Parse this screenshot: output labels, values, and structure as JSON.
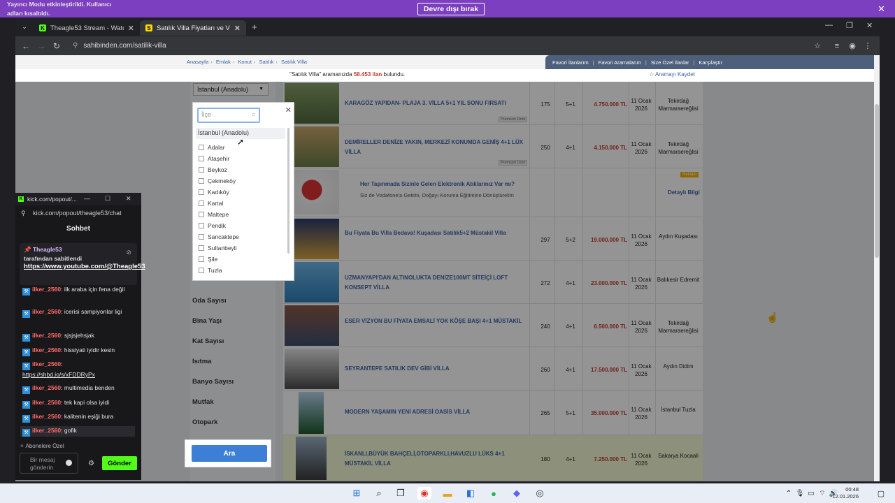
{
  "banner": {
    "message": "Yayıncı Modu etkinleştirildi. Kullanıcı adları kısaltıldı.",
    "button": "Devre dışı bırak",
    "close": "✕"
  },
  "browser": {
    "tabs": [
      {
        "title": "Theagle53 Stream - Watch Live",
        "favicon_letter": "K",
        "favicon_color": "#53fc18",
        "active": false
      },
      {
        "title": "Satılık Villa Fiyatları ve Villa İlan",
        "favicon_letter": "S",
        "favicon_color": "#ffd800",
        "active": true
      }
    ],
    "url": "sahibinden.com/satilik-villa"
  },
  "page": {
    "breadcrumb": [
      "Anasayfa",
      "Emlak",
      "Konut",
      "Satılık",
      "Satılık Villa"
    ],
    "fav_links": [
      "Favori İlanlarım",
      "Favori Aramalarım",
      "Size Özel İlanlar",
      "Karşılaştır"
    ],
    "result": {
      "query": "\"Satılık Villa\"",
      "pre": " aramanızda ",
      "count": "58.453 ilan",
      "post": " bulundu.",
      "save": "Aramayı Kaydet"
    },
    "city_select": "İstanbul (Anadolu)",
    "facets": [
      "Oda Sayısı",
      "Bina Yaşı",
      "Kat Sayısı",
      "Isıtma",
      "Banyo Sayısı",
      "Mutfak",
      "Otopark"
    ],
    "search_button": "Ara",
    "dropdown": {
      "placeholder": "İlçe",
      "header": "İstanbul (Anadolu)",
      "options": [
        "Adalar",
        "Ataşehir",
        "Beykoz",
        "Çekmeköy",
        "Kadıköy",
        "Kartal",
        "Maltepe",
        "Pendik",
        "Sancaktepe",
        "Sultanbeyli",
        "Şile",
        "Tuzla"
      ]
    },
    "listings": [
      {
        "title": "KARAGÖZ YAPIDAN- PLAJA 3. VİLLA 5+1 YIL SONU FIRSATI",
        "m2": "175",
        "rooms": "5+1",
        "price": "4.750.000 TL",
        "date": "11 Ocak 2026",
        "location": "Tekirdağ Marmaraereğlisi",
        "badge": "Premium Ürün"
      },
      {
        "title": "DEMİRELLER DENİZE YAKIN, MERKEZİ KONUMDA GENİŞ 4+1 LÜX VİLLA",
        "m2": "250",
        "rooms": "4+1",
        "price": "4.150.000 TL",
        "date": "11 Ocak 2026",
        "location": "Tekirdağ Marmaraereğlisi",
        "badge": "Premium Ürün"
      },
      {
        "title": "Her Taşınmada Sizinle Gelen Elektronik Atıklarınız Var mı?",
        "subtitle": "Siz de Vodafone'a Getirin, Doğayı Koruma Eğitimine Dönüştürelim",
        "ad_badge": "Reklam",
        "ad_link": "Detaylı Bilgi"
      },
      {
        "title": "Bu Fiyata Bu Villa Bedava! Kuşadası Satılık5+2 Müstakil Villa",
        "m2": "297",
        "rooms": "5+2",
        "price": "19.000.000 TL",
        "date": "11 Ocak 2026",
        "location": "Aydın Kuşadası"
      },
      {
        "title": "UZMANYAPI'DAN ALTINOLUKTA DENİZE100MT SİTEİÇİ LOFT KONSEPT VİLLA",
        "m2": "272",
        "rooms": "4+1",
        "price": "23.000.000 TL",
        "date": "11 Ocak 2026",
        "location": "Balıkesir Edremit"
      },
      {
        "title": "ESER VİZYON BU FİYATA EMSALİ YOK KÖŞE BAŞI 4+1 MÜSTAKİL",
        "m2": "240",
        "rooms": "4+1",
        "price": "6.500.000 TL",
        "date": "11 Ocak 2026",
        "location": "Tekirdağ Marmaraereğlisi"
      },
      {
        "title": "SEYRANTEPE SATILIK DEV GİBİ VİLLA",
        "m2": "260",
        "rooms": "4+1",
        "price": "17.500.000 TL",
        "date": "11 Ocak 2026",
        "location": "Aydın Didim"
      },
      {
        "title": "MODERN YAŞAMIN YENİ ADRESİ OASİS VİLLA",
        "m2": "265",
        "rooms": "5+1",
        "price": "35.000.000 TL",
        "date": "11 Ocak 2026",
        "location": "İstanbul Tuzla"
      },
      {
        "title": "İSKANLI,BÜYÜK BAHÇELİ,OTOPARKLI,HAVUZLU LÜKS 4+1 MÜSTAKİL VİLLA",
        "m2": "180",
        "rooms": "4+1",
        "price": "7.250.000 TL",
        "date": "11 Ocak 2026",
        "location": "Sakarya Kocaali"
      }
    ]
  },
  "chat": {
    "window_title": "kick.com/popout/...",
    "url": "kick.com/popout/theagle53/chat",
    "heading": "Sohbet",
    "pinned_user": "Theagle53",
    "pinned_by": "tarafından sabitlendi",
    "pinned_link": "https://www.youtube.com/@Theagle53",
    "messages": [
      {
        "user": "ilker_2560",
        "text": "ilk araba için fena değil"
      },
      {
        "user": "ilker_2560",
        "text": "icerisi sampiyonlar ligi"
      },
      {
        "user": "ilker_2560",
        "text": "sjsjsjehsjak"
      },
      {
        "user": "ilker_2560",
        "text": "hissiyati iyidir kesin"
      },
      {
        "user": "ilker_2560",
        "text": "https://shbd.io/s/xFDDRyPx"
      },
      {
        "user": "ilker_2560",
        "text": "multimedia benden"
      },
      {
        "user": "ilker_2560",
        "text": "tek kapi olsa iyidi"
      },
      {
        "user": "ilker_2560",
        "text": "kalitenin eşiği bura"
      },
      {
        "user": "ilker_2560",
        "text": "gofik"
      }
    ],
    "subs_only": "Abonelere Özel",
    "input_placeholder": "Bir mesaj gönderin",
    "send": "Gönder"
  },
  "taskbar": {
    "time": "00:48",
    "date": "12.01.2026"
  }
}
